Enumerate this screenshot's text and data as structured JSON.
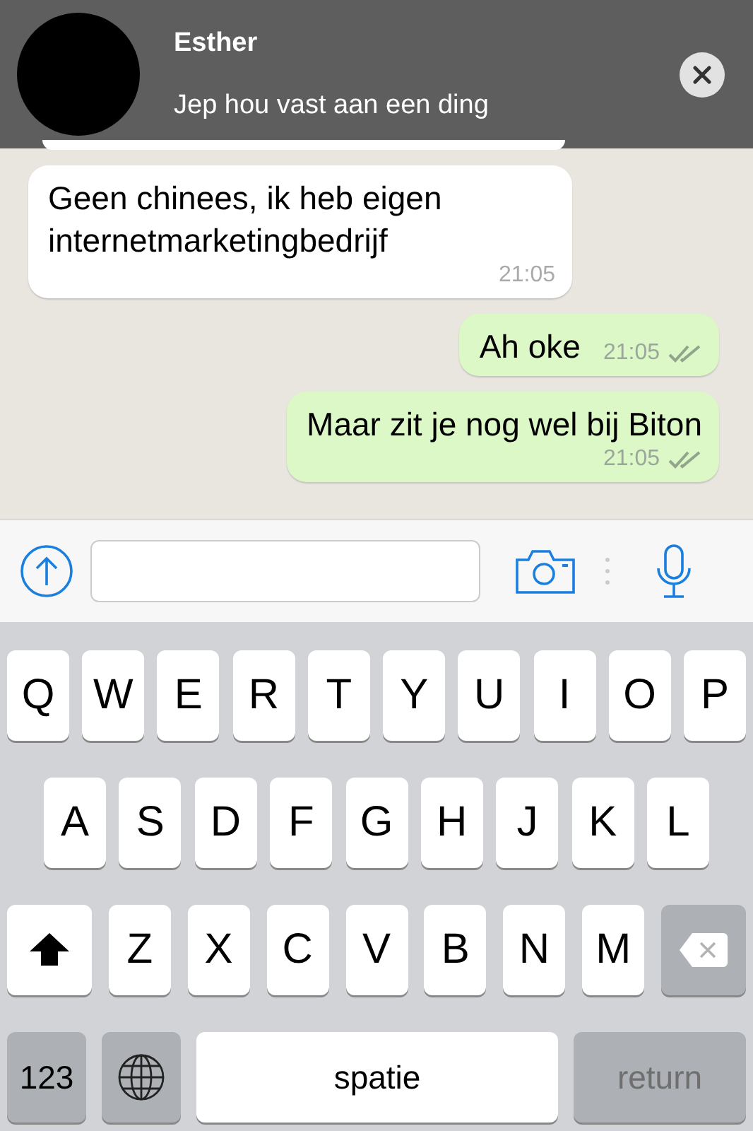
{
  "notification": {
    "sender": "Esther",
    "message": "Jep hou vast aan een ding"
  },
  "messages": [
    {
      "kind": "incoming",
      "text": "Geen chinees, ik heb eigen internetmarketingbedrijf",
      "time": "21:05"
    },
    {
      "kind": "outgoing",
      "text": "Ah oke",
      "time": "21:05",
      "inline_time": true
    },
    {
      "kind": "outgoing",
      "text": "Maar zit je nog wel bij Biton",
      "time": "21:05",
      "inline_time": false
    }
  ],
  "keyboard": {
    "rows": [
      {
        "keys": [
          {
            "kind": "letter",
            "label": "Q"
          },
          {
            "kind": "letter",
            "label": "W"
          },
          {
            "kind": "letter",
            "label": "E"
          },
          {
            "kind": "letter",
            "label": "R"
          },
          {
            "kind": "letter",
            "label": "T"
          },
          {
            "kind": "letter",
            "label": "Y"
          },
          {
            "kind": "letter",
            "label": "U"
          },
          {
            "kind": "letter",
            "label": "I"
          },
          {
            "kind": "letter",
            "label": "O"
          },
          {
            "kind": "letter",
            "label": "P"
          }
        ]
      },
      {
        "keys": [
          {
            "kind": "letter",
            "label": "A"
          },
          {
            "kind": "letter",
            "label": "S"
          },
          {
            "kind": "letter",
            "label": "D"
          },
          {
            "kind": "letter",
            "label": "F"
          },
          {
            "kind": "letter",
            "label": "G"
          },
          {
            "kind": "letter",
            "label": "H"
          },
          {
            "kind": "letter",
            "label": "J"
          },
          {
            "kind": "letter",
            "label": "K"
          },
          {
            "kind": "letter",
            "label": "L"
          }
        ]
      },
      {
        "keys": [
          {
            "kind": "shift"
          },
          {
            "kind": "letter",
            "label": "Z"
          },
          {
            "kind": "letter",
            "label": "X"
          },
          {
            "kind": "letter",
            "label": "C"
          },
          {
            "kind": "letter",
            "label": "V"
          },
          {
            "kind": "letter",
            "label": "B"
          },
          {
            "kind": "letter",
            "label": "N"
          },
          {
            "kind": "letter",
            "label": "M"
          },
          {
            "kind": "delete"
          }
        ]
      },
      {
        "keys": [
          {
            "kind": "numbers",
            "label": "123"
          },
          {
            "kind": "globe"
          },
          {
            "kind": "space",
            "label": "spatie"
          },
          {
            "kind": "return",
            "label": "return",
            "disabled": true
          }
        ]
      }
    ]
  }
}
